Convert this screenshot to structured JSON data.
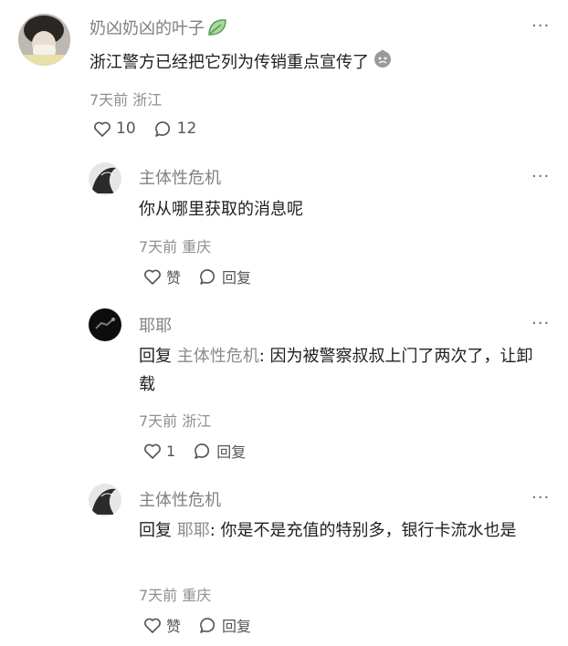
{
  "comment": {
    "username": "奶凶奶凶的叶子",
    "text": "浙江警方已经把它列为传销重点宣传了",
    "time": "7天前",
    "location": "浙江",
    "likes": "10",
    "replies_count": "12",
    "more": "···"
  },
  "replies": [
    {
      "username": "主体性危机",
      "text": "你从哪里获取的消息呢",
      "time": "7天前",
      "location": "重庆",
      "like_label": "赞",
      "reply_label": "回复",
      "more": "···"
    },
    {
      "username": "耶耶",
      "reply_prefix": "回复",
      "reply_to": "主体性危机",
      "text": ": 因为被警察叔叔上门了两次了，让卸载",
      "time": "7天前",
      "location": "浙江",
      "like_label": "1",
      "reply_label": "回复",
      "more": "···"
    },
    {
      "username": "主体性危机",
      "reply_prefix": "回复",
      "reply_to": "耶耶",
      "text": ": 你是不是充值的特别多，银行卡流水也是",
      "time": "7天前",
      "location": "重庆",
      "like_label": "赞",
      "reply_label": "回复",
      "more": "···"
    }
  ],
  "colors": {
    "name": "#808080",
    "meta": "#8f8f8f",
    "text": "#1f1f1f"
  },
  "icons": {
    "like": "heart-outline-icon",
    "comment": "speech-bubble-icon",
    "more": "more-dots-icon"
  }
}
